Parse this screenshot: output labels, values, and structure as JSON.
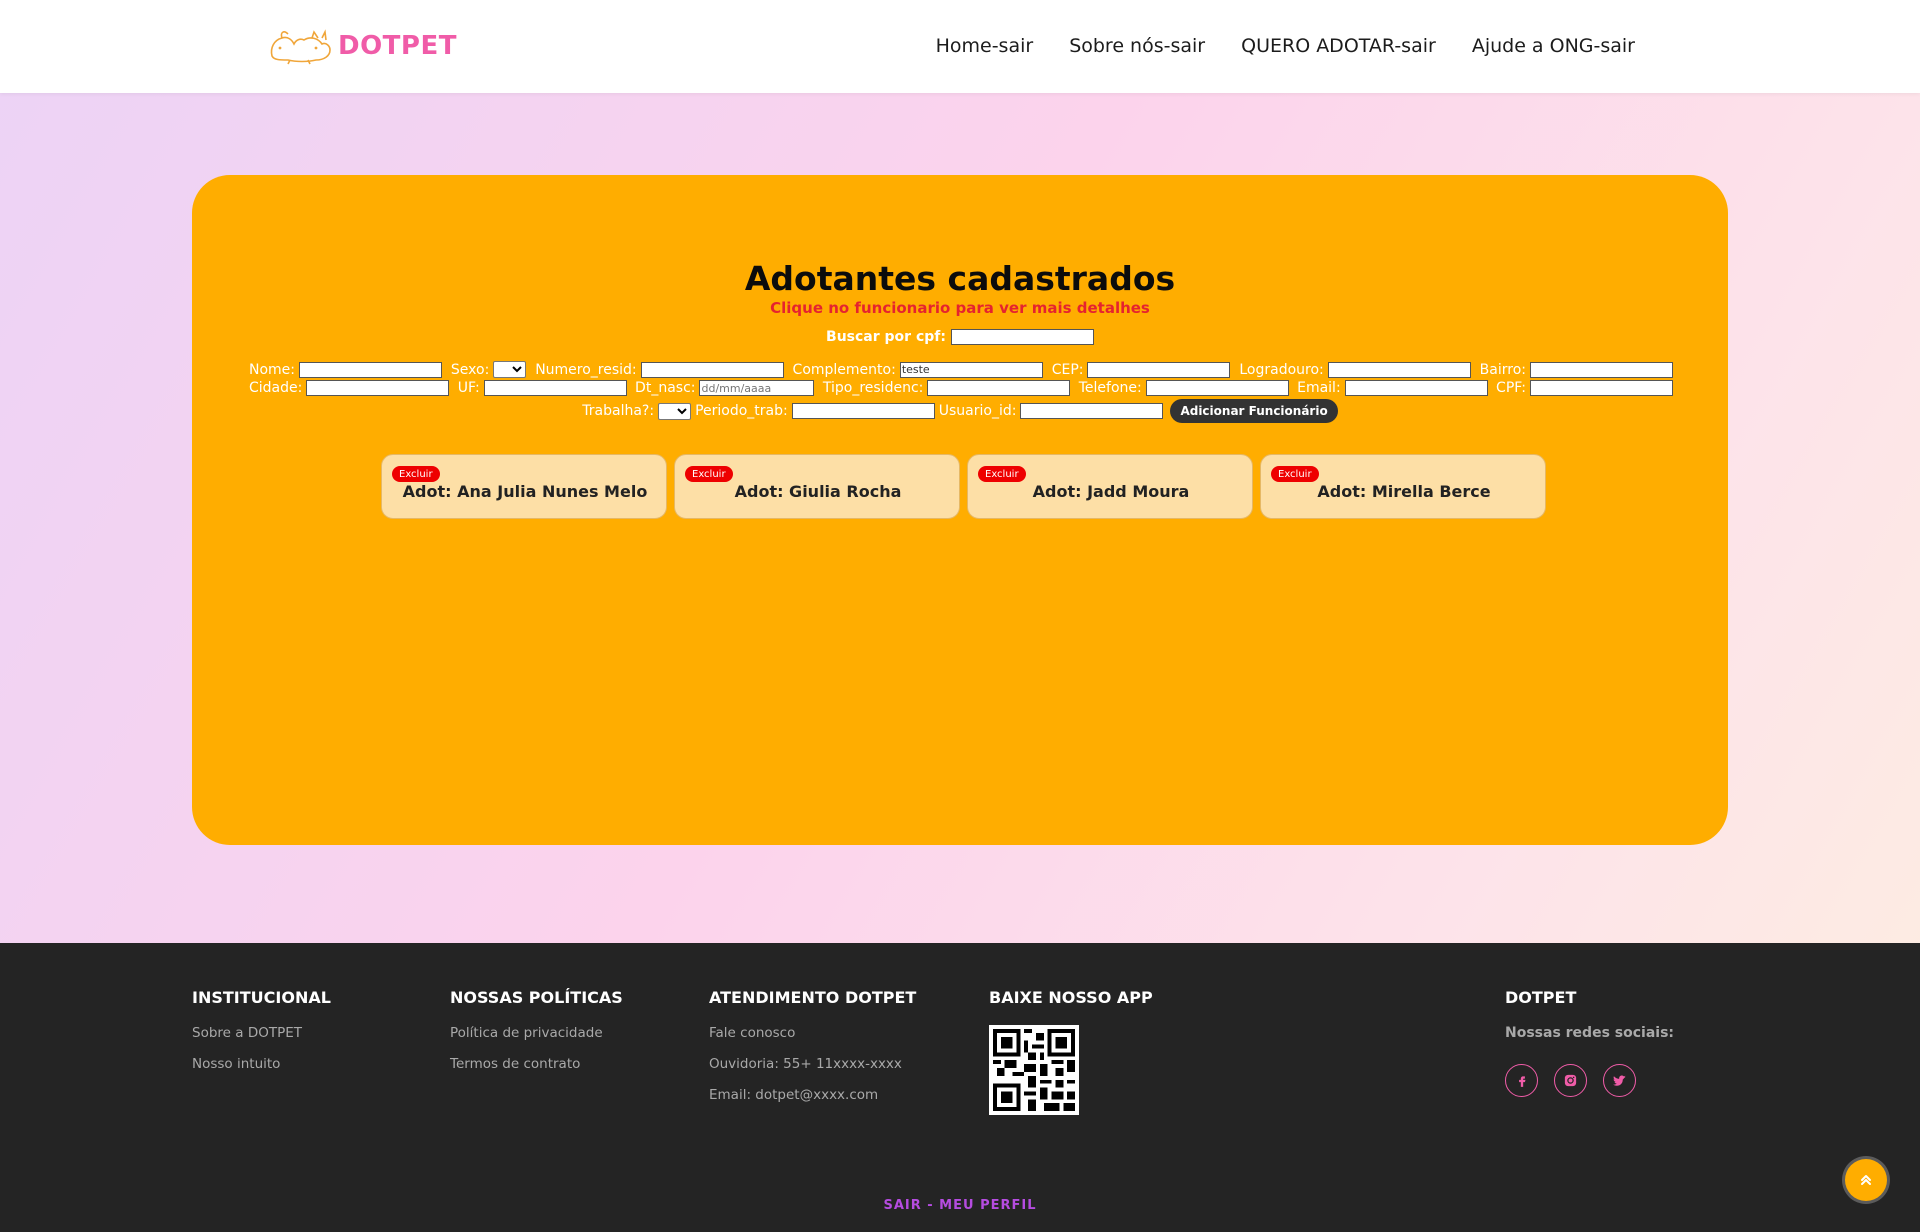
{
  "header": {
    "logo_text": "DOTPET",
    "nav": [
      "Home-sair",
      "Sobre nós-sair",
      "QUERO ADOTAR-sair",
      "Ajude a ONG-sair"
    ]
  },
  "main": {
    "title": "Adotantes cadastrados",
    "subtitle": "Clique no funcionario para ver mais detalhes",
    "search_label": "Buscar por cpf:",
    "form": {
      "nome_label": "Nome:",
      "sexo_label": "Sexo:",
      "numero_resid_label": "Numero_resid:",
      "complemento_label": "Complemento:",
      "complemento_value": "teste",
      "cep_label": "CEP:",
      "logradouro_label": "Logradouro:",
      "bairro_label": "Bairro:",
      "cidade_label": "Cidade:",
      "uf_label": "UF:",
      "dt_nasc_label": "Dt_nasc:",
      "dt_nasc_placeholder": "dd/mm/aaaa",
      "tipo_residenc_label": "Tipo_residenc:",
      "telefone_label": "Telefone:",
      "email_label": "Email:",
      "cpf_label": "CPF:",
      "trabalha_label": "Trabalha?:",
      "periodo_trab_label": "Periodo_trab:",
      "usuario_id_label": "Usuario_id:",
      "add_button": "Adicionar Funcionário"
    },
    "adopters": [
      {
        "delete_label": "Excluir",
        "name": "Adot: Ana Julia Nunes Melo"
      },
      {
        "delete_label": "Excluir",
        "name": "Adot: Giulia Rocha"
      },
      {
        "delete_label": "Excluir",
        "name": "Adot: Jadd Moura"
      },
      {
        "delete_label": "Excluir",
        "name": "Adot: Mirella Berce"
      }
    ]
  },
  "footer": {
    "institucional": {
      "title": "INSTITUCIONAL",
      "links": [
        "Sobre a DOTPET",
        "Nosso intuito"
      ]
    },
    "politicas": {
      "title": "NOSSAS POLÍTICAS",
      "links": [
        "Política de privacidade",
        "Termos de contrato"
      ]
    },
    "atendimento": {
      "title": "ATENDIMENTO DOTPET",
      "links": [
        "Fale conosco",
        "Ouvidoria: 55+ 11xxxx-xxxx",
        "Email: dotpet@xxxx.com"
      ]
    },
    "app": {
      "title": "BAIXE NOSSO APP"
    },
    "dotpet": {
      "title": "DOTPET",
      "social_label": "Nossas redes sociais:"
    },
    "bottom_link": "SAIR - MEU PERFIL"
  },
  "colors": {
    "accent_orange": "#ffad00",
    "brand_pink": "#f05ca8",
    "delete_red": "#ee0000",
    "footer_bg": "#242424",
    "bottom_link_purple": "#b54ce0"
  },
  "icons": [
    "dog-cat-logo-icon",
    "facebook-icon",
    "instagram-icon",
    "twitter-icon",
    "chevron-up-double-icon",
    "qr-code-icon"
  ]
}
